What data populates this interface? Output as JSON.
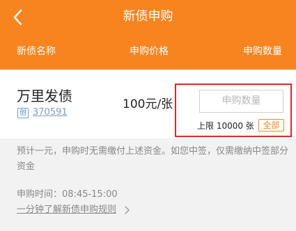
{
  "header": {
    "title": "新债申购",
    "columns": {
      "name": "新债名称",
      "price": "申购价格",
      "quantity": "申购数量"
    },
    "background_color": "#f7841f"
  },
  "bond": {
    "name": "万里发债",
    "tag": "创",
    "code": "370591",
    "price": "100元/张"
  },
  "subscription": {
    "quantity_placeholder": "申购数量",
    "limit": "上限 10000 张",
    "all_label": "全部"
  },
  "notice": {
    "text": "预计一元，申购时无需缴付上述资金。如您中签，仅需缴纳中签部分资金",
    "time": "申购时间：08:45-15:00",
    "rules_link": "一分钟了解新债申购规则"
  },
  "icons": {
    "back": "chevron-left-icon",
    "rules_arrow": "chevron-right-icon"
  }
}
